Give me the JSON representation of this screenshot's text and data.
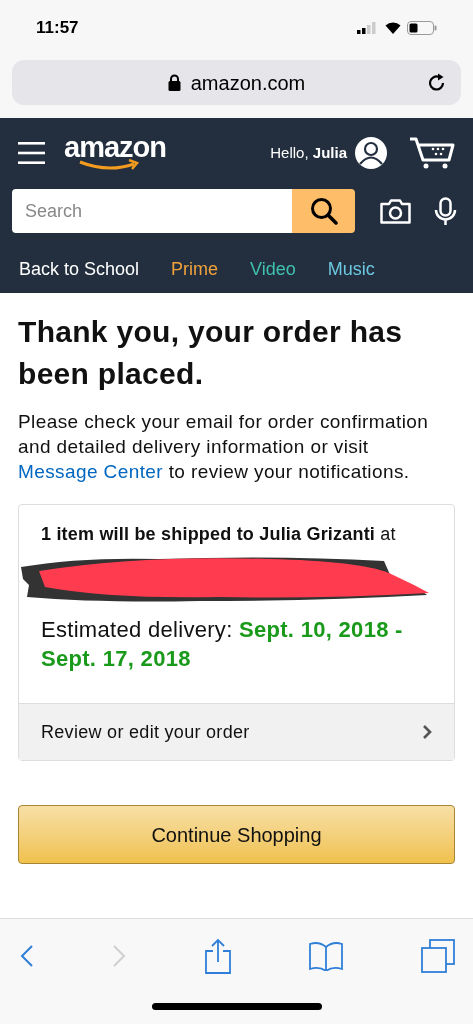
{
  "status_bar": {
    "time": "11:57"
  },
  "address_bar": {
    "url": "amazon.com"
  },
  "header": {
    "logo": "amazon",
    "greeting": "Hello,",
    "user_name": "Julia"
  },
  "search": {
    "placeholder": "Search"
  },
  "nav_links": [
    {
      "label": "Back to School",
      "color": "#ffffff"
    },
    {
      "label": "Prime",
      "color": "#f0a23b"
    },
    {
      "label": "Video",
      "color": "#3fc1b0"
    },
    {
      "label": "Music",
      "color": "#6cc8e0"
    }
  ],
  "confirmation": {
    "title": "Thank you, your order has been placed.",
    "message": "Please check your email for order confirmation and detailed delivery information or visit",
    "link": "Message Center",
    "message_end": "to review your notifications."
  },
  "order_card": {
    "shipping_text": "**1 item will be shipped to Julia Grizanti** at",
    "address_redacted": true,
    "delivery_label": "Estimated delivery:",
    "delivery_dates": "Sept. 10, 2018 - Sept. 17, 2018",
    "review_link": "Review or edit your order"
  },
  "continue_button": "Continue Shopping",
  "toolbar": [
    {
      "kind": "back",
      "disabled": false
    },
    {
      "kind": "forward",
      "disabled": true
    },
    {
      "kind": "share",
      "disabled": false
    },
    {
      "kind": "bookmarks",
      "disabled": false
    },
    {
      "kind": "tabs",
      "disabled": false
    }
  ]
}
